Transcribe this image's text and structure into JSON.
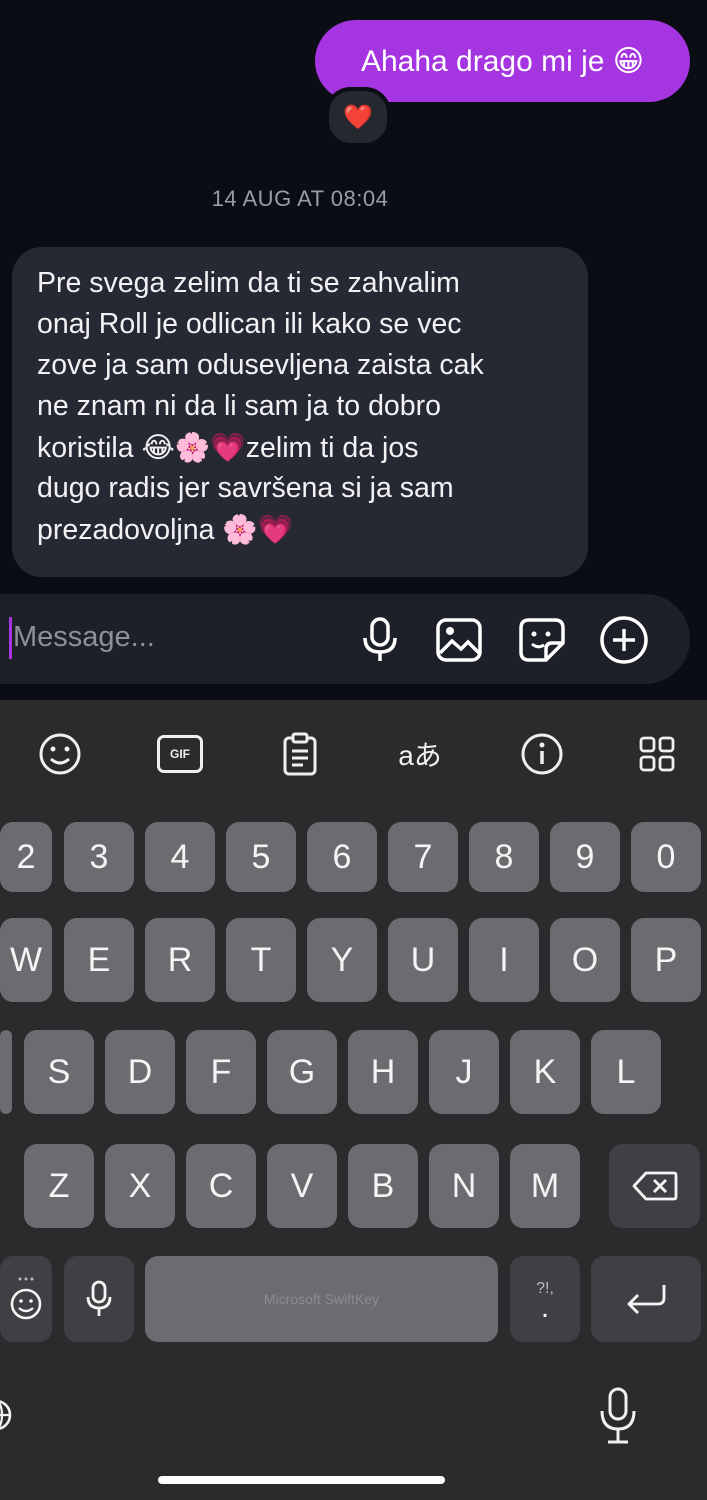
{
  "chat": {
    "outgoing_message": "Ahaha drago mi je 😁",
    "reaction": "❤️",
    "timestamp": "14 AUG AT 08:04",
    "incoming_lines": [
      "Pre svega zelim da ti se zahvalim",
      "onaj Roll je odlican ili kako se vec",
      "zove ja sam odusevljena zaista cak",
      "ne znam ni da li sam ja to dobro",
      "koristila 😂🌸💗zelim ti da jos",
      "dugo radis jer savršena si ja sam",
      "prezadovoljna 🌸💗"
    ]
  },
  "composer": {
    "placeholder": "Message...",
    "icons": [
      "microphone-icon",
      "gallery-icon",
      "sticker-icon",
      "add-icon"
    ]
  },
  "keyboard": {
    "toolbar_icons": [
      "emoji-icon",
      "gif-icon",
      "clipboard-icon",
      "translate-icon",
      "info-icon",
      "apps-grid-icon"
    ],
    "gif_label": "GIF",
    "translate_label": "aあ",
    "number_row": [
      "2",
      "3",
      "4",
      "5",
      "6",
      "7",
      "8",
      "9",
      "0"
    ],
    "row1": [
      "W",
      "E",
      "R",
      "T",
      "Y",
      "U",
      "I",
      "O",
      "P"
    ],
    "row2": [
      "S",
      "D",
      "F",
      "G",
      "H",
      "J",
      "K",
      "L"
    ],
    "row3": [
      "Z",
      "X",
      "C",
      "V",
      "B",
      "N",
      "M"
    ],
    "space_label": "Microsoft SwiftKey",
    "punct_key_top": "?!,",
    "punct_key_bottom": "."
  },
  "colors": {
    "outgoing_bubble": "#a435e0",
    "incoming_bubble": "#262933",
    "background": "#0b0d14",
    "key": "#6c6c70",
    "keyboard": "#2b2b2d"
  }
}
